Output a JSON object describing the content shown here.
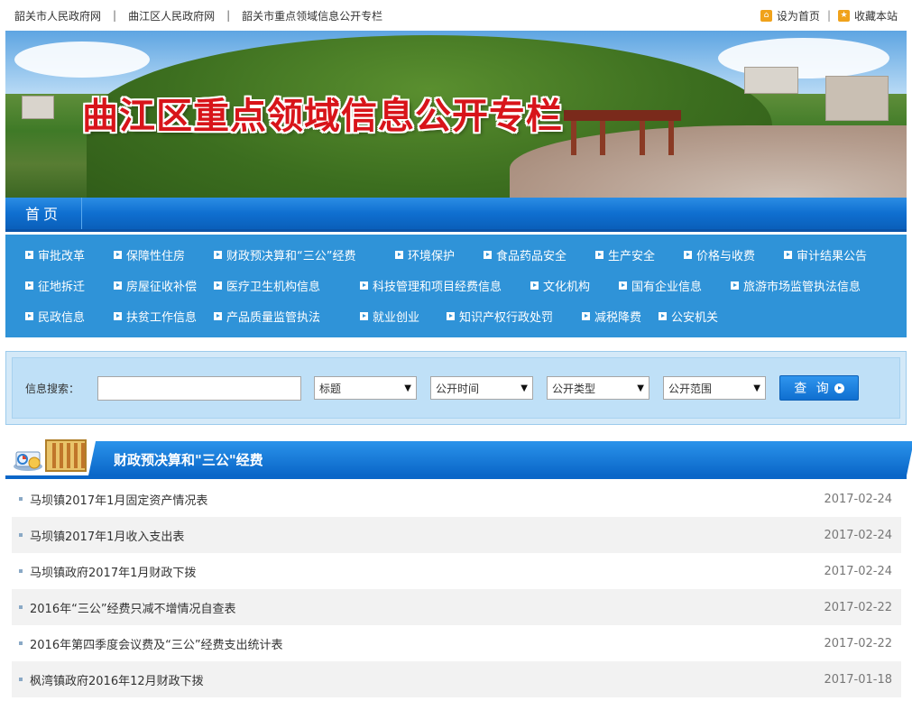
{
  "topbar": {
    "links": [
      "韶关市人民政府网",
      "曲江区人民政府网",
      "韶关市重点领域信息公开专栏"
    ],
    "set_home": "设为首页",
    "favorite": "收藏本站"
  },
  "banner": {
    "title": "曲江区重点领域信息公开专栏"
  },
  "nav": {
    "home": "首页"
  },
  "categories": [
    [
      "审批改革",
      "保障性住房",
      "财政预决算和“三公”经费",
      "环境保护",
      "食品药品安全",
      "生产安全",
      "价格与收费",
      "审计结果公告"
    ],
    [
      "征地拆迁",
      "房屋征收补偿",
      "医疗卫生机构信息",
      "科技管理和项目经费信息",
      "文化机构",
      "国有企业信息",
      "旅游市场监管执法信息"
    ],
    [
      "民政信息",
      "扶贫工作信息",
      "产品质量监管执法",
      "就业创业",
      "知识产权行政处罚",
      "减税降费",
      "公安机关"
    ]
  ],
  "search": {
    "label": "信息搜索：",
    "input_value": "",
    "selects": [
      "标题",
      "公开时间",
      "公开类型",
      "公开范围"
    ],
    "button": "查 询"
  },
  "section": {
    "title": "财政预决算和\"三公\"经费"
  },
  "items": [
    {
      "title": "马坝镇2017年1月固定资产情况表",
      "date": "2017-02-24"
    },
    {
      "title": "马坝镇2017年1月收入支出表",
      "date": "2017-02-24"
    },
    {
      "title": "马坝镇政府2017年1月财政下拨",
      "date": "2017-02-24"
    },
    {
      "title": "2016年“三公”经费只减不增情况自查表",
      "date": "2017-02-22"
    },
    {
      "title": "2016年第四季度会议费及“三公”经费支出统计表",
      "date": "2017-02-22"
    },
    {
      "title": "枫湾镇政府2016年12月财政下拨",
      "date": "2017-01-18"
    }
  ],
  "colors": {
    "accent_blue": "#0f6fd0",
    "panel_blue": "#2f93d8",
    "title_red": "#d8141a",
    "star_orange": "#f0a21b"
  }
}
